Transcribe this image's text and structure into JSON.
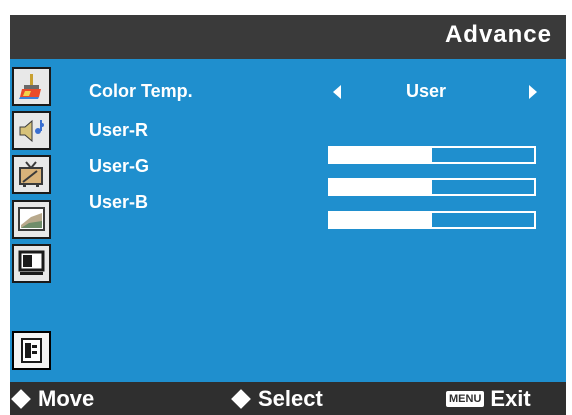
{
  "header": {
    "title": "Advance"
  },
  "sidebar": {
    "items": [
      {
        "icon": "paint-brush-icon"
      },
      {
        "icon": "speaker-music-icon"
      },
      {
        "icon": "tv-antenna-icon"
      },
      {
        "icon": "picture-frame-icon"
      },
      {
        "icon": "display-screen-icon"
      },
      {
        "icon": "advance-settings-icon",
        "selected": true
      }
    ]
  },
  "rows": {
    "color_temp": {
      "label": "Color Temp.",
      "value": "User"
    },
    "user_r": {
      "label": "User-R",
      "level_fraction": 0.5
    },
    "user_g": {
      "label": "User-G",
      "level_fraction": 0.5
    },
    "user_b": {
      "label": "User-B",
      "level_fraction": 0.5
    }
  },
  "footer": {
    "move_label": "Move",
    "select_label": "Select",
    "menu_chip": "MENU",
    "exit_label": "Exit"
  },
  "colors": {
    "panel_blue": "#1f8fce",
    "frame_dark": "#2f2f2f",
    "text": "#ffffff"
  }
}
